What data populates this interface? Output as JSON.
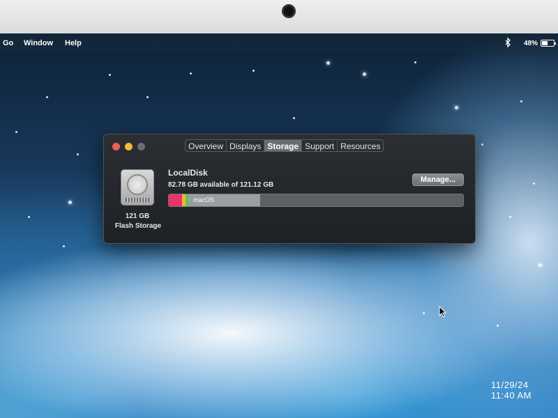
{
  "menubar": {
    "items": [
      "Go",
      "Window",
      "Help"
    ],
    "battery_percent": "48%",
    "battery_level": 0.48,
    "icons": [
      "bluetooth-icon",
      "battery-icon"
    ]
  },
  "window": {
    "tabs": [
      "Overview",
      "Displays",
      "Storage",
      "Support",
      "Resources"
    ],
    "active_tab": "Storage",
    "disk": {
      "size": "121 GB",
      "type": "Flash Storage",
      "name": "LocalDisk",
      "availability": "82.78 GB available of 121.12 GB"
    },
    "manage_label": "Manage...",
    "storage_bar": {
      "segments": [
        {
          "label": "",
          "color": "#e8336b",
          "fraction": 0.045
        },
        {
          "label": "",
          "color": "#f0b43a",
          "fraction": 0.012
        },
        {
          "label": "",
          "color": "#63c35a",
          "fraction": 0.012
        },
        {
          "label": "macOS",
          "color": "#9a9da2",
          "fraction": 0.241
        },
        {
          "label": "",
          "color": "#5c5f64",
          "fraction": 0.69
        }
      ]
    }
  },
  "clock": {
    "date": "11/29/24",
    "time": "11:40 AM"
  }
}
